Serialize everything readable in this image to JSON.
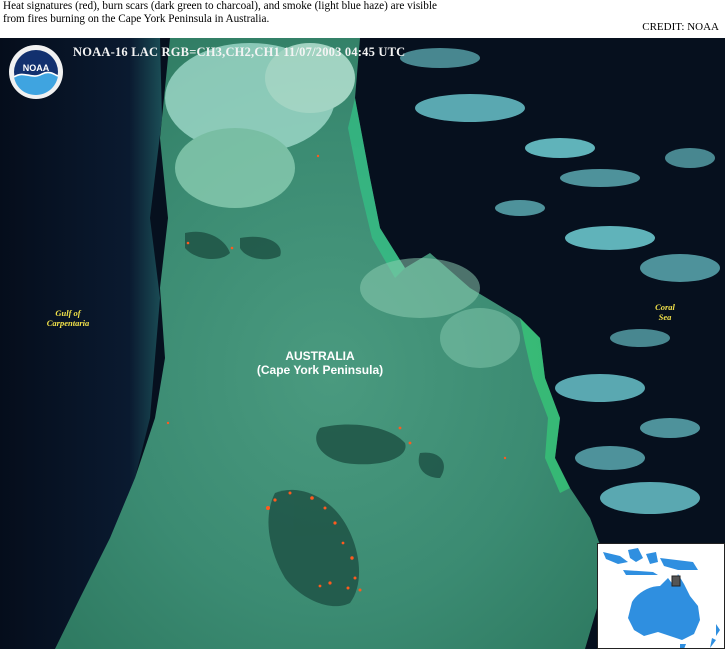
{
  "caption": {
    "line1": "Heat signatures (red), burn scars (dark green to charcoal), and smoke (light blue haze) are visible",
    "line2": "from fires burning on the Cape York Peninsula in Australia.",
    "credit": "CREDIT: NOAA"
  },
  "image": {
    "sat_title": "NOAA-16  LAC  RGB=CH3,CH2,CH1  11/07/2003  04:45 UTC",
    "logo_text": "NOAA",
    "labels": {
      "gulf_line1": "Gulf of",
      "gulf_line2": "Carpentaria",
      "coral_line1": "Coral",
      "coral_line2": "Sea",
      "australia_line1": "AUSTRALIA",
      "australia_line2": "(Cape York Peninsula)"
    }
  },
  "colors": {
    "land": "#3e8f78",
    "ocean": "#06101e",
    "cloud": "#7fe9ef",
    "fire": "#ff5a1e",
    "label_yellow": "#f2e24a",
    "inset_ocean": "#ffffff",
    "inset_land": "#2f8fe0"
  }
}
